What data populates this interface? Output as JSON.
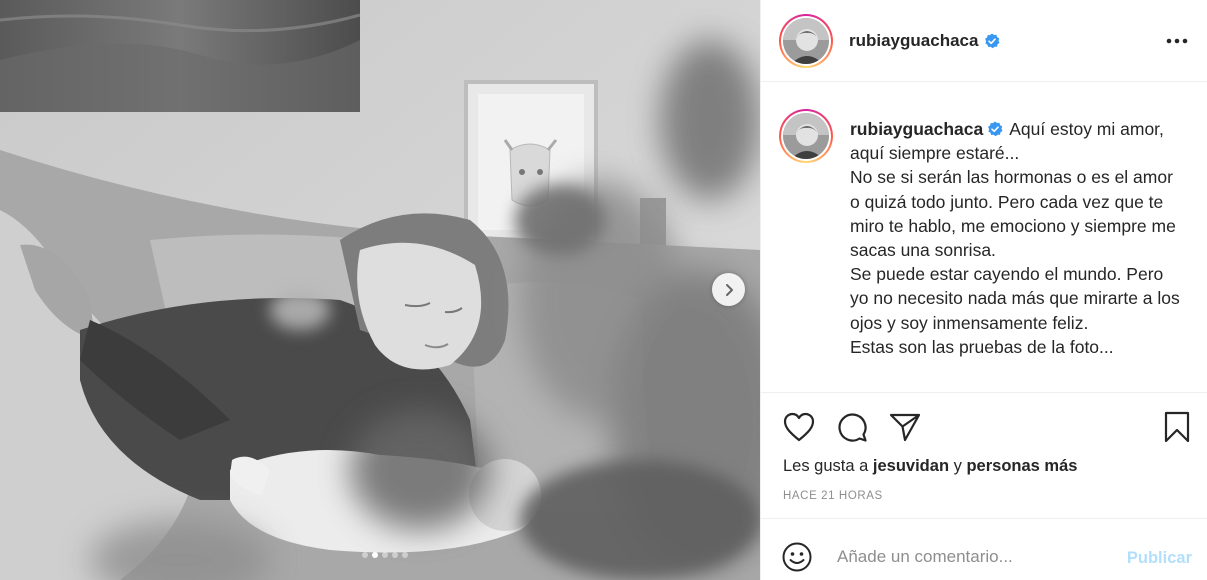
{
  "photo": {
    "alt": "",
    "carousel_total": 5,
    "carousel_active": 2
  },
  "header": {
    "username": "rubiayguachaca",
    "verified": true
  },
  "caption": {
    "username": "rubiayguachaca",
    "lines": [
      "Aquí estoy mi amor, aquí siempre estaré...",
      "No se si serán las hormonas o es el amor o quizá todo junto. Pero cada vez que te miro te hablo, me emociono y siempre me sacas una sonrisa.",
      "Se puede estar cayendo el mundo. Pero yo no necesito nada más que mirarte a los ojos y soy inmensamente feliz.",
      "Estas son las pruebas de la foto..."
    ]
  },
  "actions": {
    "likes_prefix": "Les gusta a",
    "likes_user": "jesuvidan",
    "likes_conjunction": "y",
    "likes_others": "personas más",
    "timestamp": "HACE 21 HORAS"
  },
  "comment": {
    "placeholder": "Añade un comentario...",
    "publish_label": "Publicar"
  },
  "colors": {
    "verified": "#3897f0",
    "publish_disabled": "#b2dffc",
    "muted": "#8e8e8e",
    "text": "#262626"
  }
}
